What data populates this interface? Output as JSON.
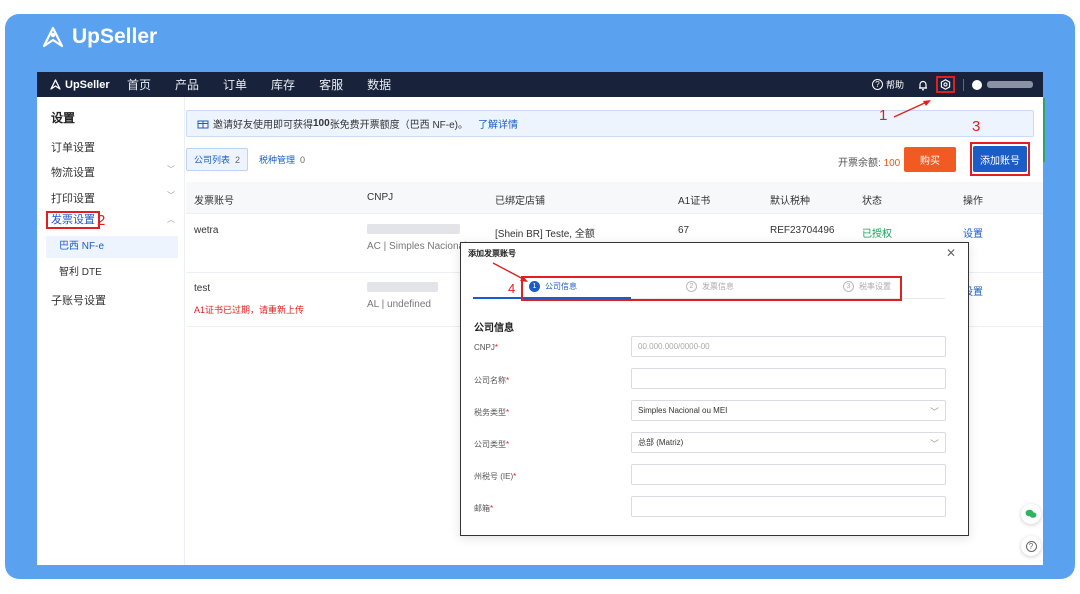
{
  "brand": {
    "name": "UpSeller"
  },
  "nav": {
    "logo": "UpSeller",
    "items": [
      "首页",
      "产品",
      "订单",
      "库存",
      "客服",
      "数据"
    ],
    "help": "帮助"
  },
  "sidebar": {
    "title": "设置",
    "items": {
      "orders": "订单设置",
      "logistics": "物流设置",
      "print": "打印设置",
      "invoice": "发票设置",
      "brazil": "巴西 NF-e",
      "chile": "智利 DTE",
      "subaccount": "子账号设置"
    }
  },
  "annotations": {
    "a1": "1",
    "a2": "2",
    "a3": "3",
    "a4": "4"
  },
  "notice": {
    "text_before": "邀请好友使用即可获得",
    "bold": "100",
    "text_after": "张免费开票额度（巴西 NF-e)。",
    "link": "了解详情"
  },
  "tabs": {
    "company_list": "公司列表",
    "company_count": "2",
    "tax_mgmt": "税种管理",
    "tax_count": "0"
  },
  "balance": {
    "label": "开票余额:",
    "value": "100"
  },
  "buttons": {
    "buy": "购买",
    "add_account": "添加账号"
  },
  "table": {
    "headers": [
      "发票账号",
      "CNPJ",
      "已绑定店铺",
      "A1证书",
      "默认税种",
      "状态",
      "操作"
    ],
    "rows": [
      {
        "account": "wetra",
        "cnpj_sub": "AC | Simples Nacional",
        "store": "[Shein BR] Teste, 全额",
        "cert": "67",
        "tax": "REF23704496",
        "status": "已授权",
        "action": "设置"
      },
      {
        "account": "test",
        "warning": "A1证书已过期，请重新上传",
        "cnpj_sub": "AL | undefined",
        "action": "设置"
      }
    ]
  },
  "modal": {
    "title": "添加发票账号",
    "steps": [
      {
        "num": "1",
        "label": "公司信息"
      },
      {
        "num": "2",
        "label": "发票信息"
      },
      {
        "num": "3",
        "label": "税率设置"
      }
    ],
    "section": "公司信息",
    "fields": {
      "cnpj": {
        "label": "CNPJ",
        "placeholder": "00.000.000/0000-00"
      },
      "company_name": {
        "label": "公司名称"
      },
      "tax_type": {
        "label": "税务类型",
        "value": "Simples Nacional ou MEI"
      },
      "company_type": {
        "label": "公司类型",
        "value": "总部 (Matriz)"
      },
      "state_tax": {
        "label": "州税号 (IE)"
      },
      "email": {
        "label": "邮箱"
      }
    }
  }
}
